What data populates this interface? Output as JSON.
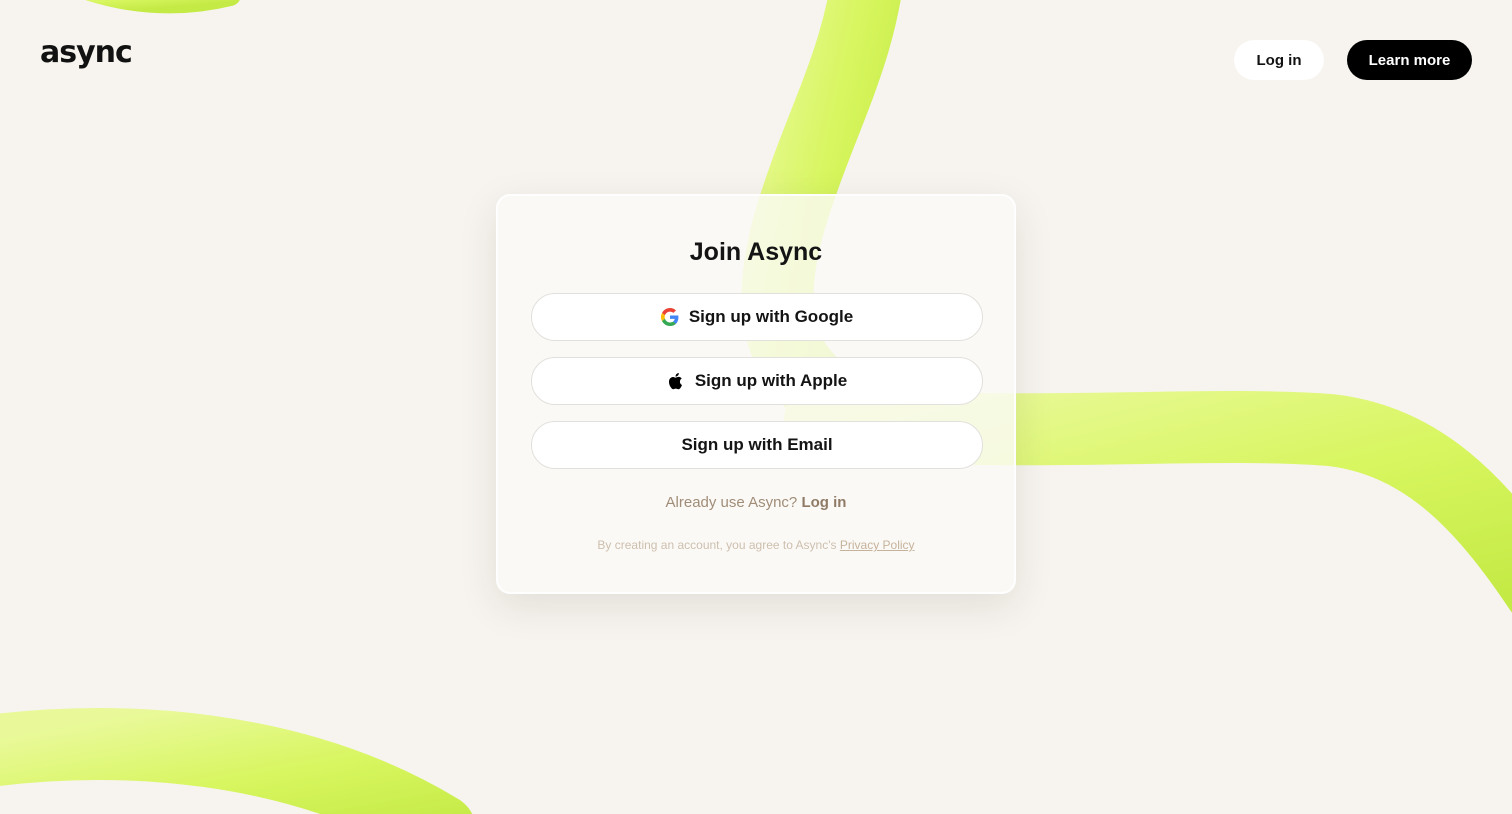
{
  "header": {
    "logo": "async",
    "login_label": "Log in",
    "learn_more_label": "Learn more"
  },
  "card": {
    "title": "Join Async",
    "google_label": "Sign up with Google",
    "apple_label": "Sign up with Apple",
    "email_label": "Sign up with Email",
    "already_text": "Already use Async?",
    "already_link": "Log in",
    "legal_text": "By creating an account, you agree to Async's",
    "privacy_link": "Privacy Policy"
  },
  "colors": {
    "background": "#f7f4ef",
    "accent_green": "#d8f768",
    "primary_button": "#000000",
    "muted_text": "#a08d78"
  },
  "icons": [
    "google-icon",
    "apple-icon"
  ]
}
